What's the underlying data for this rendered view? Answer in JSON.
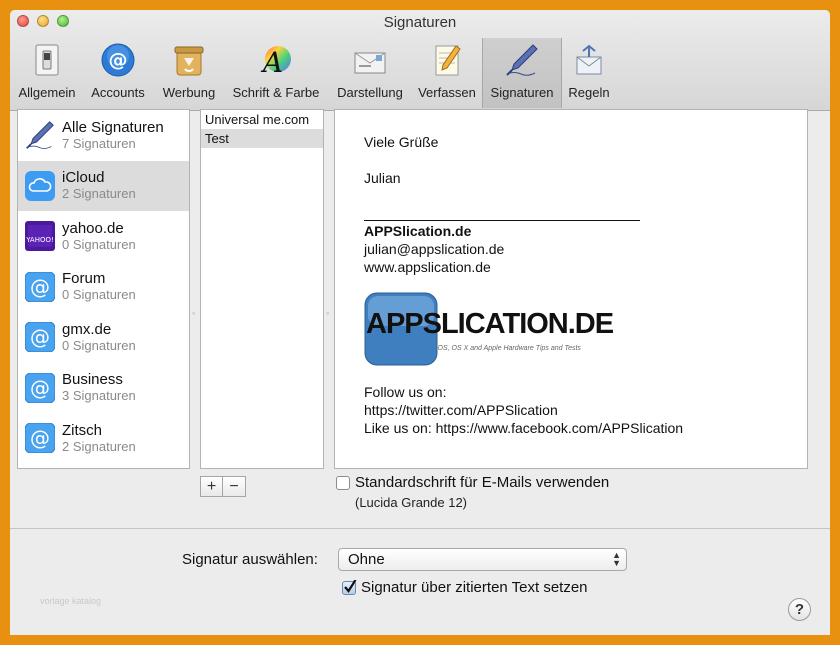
{
  "window": {
    "title": "Signaturen"
  },
  "toolbar": {
    "items": [
      {
        "label": "Allgemein",
        "icon": "switch-icon"
      },
      {
        "label": "Accounts",
        "icon": "at-icon"
      },
      {
        "label": "Werbung",
        "icon": "trash-can-icon"
      },
      {
        "label": "Schrift & Farbe",
        "icon": "font-color-icon"
      },
      {
        "label": "Darstellung",
        "icon": "envelope-icon"
      },
      {
        "label": "Verfassen",
        "icon": "pencil-paper-icon"
      },
      {
        "label": "Signaturen",
        "icon": "fountain-pen-icon",
        "active": true
      },
      {
        "label": "Regeln",
        "icon": "rules-icon"
      }
    ]
  },
  "accounts": [
    {
      "name": "Alle Signaturen",
      "count": "7 Signaturen",
      "icon": "fountain-pen-icon"
    },
    {
      "name": "iCloud",
      "count": "2 Signaturen",
      "icon": "cloud-icon",
      "selected": true
    },
    {
      "name": "yahoo.de",
      "count": "0 Signaturen",
      "icon": "yahoo-icon"
    },
    {
      "name": "Forum",
      "count": "0 Signaturen",
      "icon": "at-icon"
    },
    {
      "name": "gmx.de",
      "count": "0 Signaturen",
      "icon": "at-icon"
    },
    {
      "name": "Business",
      "count": "3 Signaturen",
      "icon": "at-icon"
    },
    {
      "name": "Zitsch",
      "count": "2 Signaturen",
      "icon": "at-icon"
    }
  ],
  "signatures": [
    {
      "name": "Universal me.com"
    },
    {
      "name": "Test",
      "selected": true
    }
  ],
  "preview": {
    "greeting": "Viele Grüße",
    "name": "Julian",
    "company": "APPSlication.de",
    "email": "julian@appslication.de",
    "website": "www.appslication.de",
    "logo_main": "APPSLICATION.DE",
    "logo_sub": "iOS, OS X and Apple Hardware Tips and Tests",
    "follow": "Follow us on:",
    "twitter": "https://twitter.com/APPSlication",
    "facebook": "Like us on: https://www.facebook.com/APPSlication"
  },
  "controls": {
    "add_label": "+",
    "remove_label": "−",
    "default_font_label": "Standardschrift für E-Mails verwenden",
    "default_font_checked": false,
    "font_name": "(Lucida Grande 12)",
    "select_label": "Signatur auswählen:",
    "select_value": "Ohne",
    "above_quote_label": "Signatur über zitierten Text setzen",
    "above_quote_checked": true,
    "help_label": "?"
  },
  "watermark": "vorlage katalog",
  "colors": {
    "accent_blue": "#2e7bd6",
    "selection": "#dcdcdc",
    "background": "#e8900f"
  }
}
